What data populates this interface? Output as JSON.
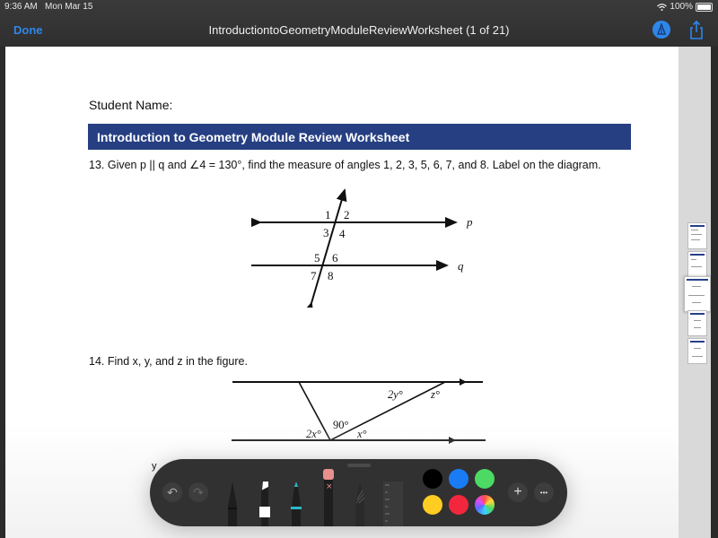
{
  "status_bar": {
    "time": "9:36 AM",
    "date": "Mon Mar 15",
    "battery": "100%"
  },
  "nav": {
    "done_label": "Done",
    "title": "IntroductiontoGeometryModuleReviewWorksheet (1 of 21)",
    "markup_icon": "markup-pen-icon",
    "share_icon": "share-icon"
  },
  "document": {
    "student_label": "Student Name:",
    "header": "Introduction to Geometry Module Review Worksheet",
    "q13": {
      "text": "13. Given p || q and ∠4 = 130°, find the measure of angles 1, 2, 3, 5, 6, 7, and 8. Label on the diagram.",
      "angle_labels": [
        "1",
        "2",
        "3",
        "4",
        "5",
        "6",
        "7",
        "8"
      ],
      "line_labels": [
        "p",
        "q"
      ]
    },
    "q14": {
      "text": "14. Find x, y, and z in the figure.",
      "labels": {
        "a": "2y°",
        "b": "z°",
        "c": "90°",
        "d": "2x°",
        "e": "x°"
      }
    },
    "stray_text": "y"
  },
  "thumbnails": {
    "count": 5,
    "selected_index": 2
  },
  "markup_toolbar": {
    "undo_icon": "undo-icon",
    "redo_icon": "redo-icon",
    "tools": [
      "pen",
      "marker",
      "pencil",
      "eraser",
      "lasso",
      "ruler"
    ],
    "colors": [
      "#000000",
      "#1a7cf5",
      "#4cd964",
      "#ffcc22",
      "#f2273d",
      "color-wheel"
    ],
    "add_label": "+",
    "more_label": "•••"
  }
}
